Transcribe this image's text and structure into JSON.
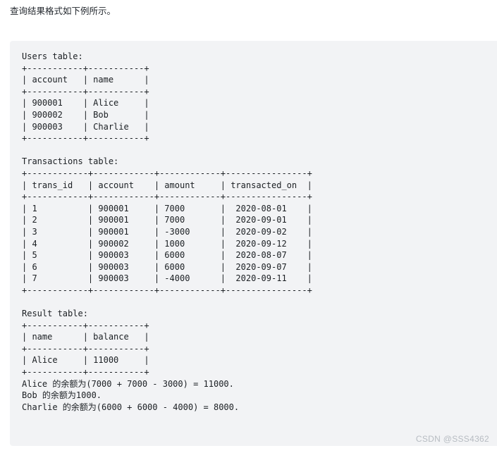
{
  "intro": {
    "text": "查询结果格式如下例所示。"
  },
  "code_block": {
    "background": "#f2f3f5",
    "text_color": "#1b1f23",
    "lines": [
      "Users table:",
      "+-----------+-----------+",
      "| account   | name      |",
      "+-----------+-----------+",
      "| 900001    | Alice     |",
      "| 900002    | Bob       |",
      "| 900003    | Charlie   |",
      "+-----------+-----------+",
      "",
      "Transactions table:",
      "+------------+------------+------------+----------------+",
      "| trans_id   | account    | amount     | transacted_on  |",
      "+------------+------------+------------+----------------+",
      "| 1          | 900001     | 7000       |  2020-08-01    |",
      "| 2          | 900001     | 7000       |  2020-09-01    |",
      "| 3          | 900001     | -3000      |  2020-09-02    |",
      "| 4          | 900002     | 1000       |  2020-09-12    |",
      "| 5          | 900003     | 6000       |  2020-08-07    |",
      "| 6          | 900003     | 6000       |  2020-09-07    |",
      "| 7          | 900003     | -4000      |  2020-09-11    |",
      "+------------+------------+------------+----------------+",
      "",
      "Result table:",
      "+-----------+-----------+",
      "| name      | balance   |",
      "+-----------+-----------+",
      "| Alice     | 11000     |",
      "+-----------+-----------+",
      "Alice 的余额为(7000 + 7000 - 3000) = 11000.",
      "Bob 的余额为1000.",
      "Charlie 的余额为(6000 + 6000 - 4000) = 8000."
    ]
  },
  "watermark": {
    "text": "CSDN @SSS4362"
  },
  "tables": {
    "users": {
      "title": "Users table:",
      "columns": [
        "account",
        "name"
      ],
      "rows": [
        [
          "900001",
          "Alice"
        ],
        [
          "900002",
          "Bob"
        ],
        [
          "900003",
          "Charlie"
        ]
      ]
    },
    "transactions": {
      "title": "Transactions table:",
      "columns": [
        "trans_id",
        "account",
        "amount",
        "transacted_on"
      ],
      "rows": [
        [
          "1",
          "900001",
          "7000",
          "2020-08-01"
        ],
        [
          "2",
          "900001",
          "7000",
          "2020-09-01"
        ],
        [
          "3",
          "900001",
          "-3000",
          "2020-09-02"
        ],
        [
          "4",
          "900002",
          "1000",
          "2020-09-12"
        ],
        [
          "5",
          "900003",
          "6000",
          "2020-08-07"
        ],
        [
          "6",
          "900003",
          "6000",
          "2020-09-07"
        ],
        [
          "7",
          "900003",
          "-4000",
          "2020-09-11"
        ]
      ]
    },
    "result": {
      "title": "Result table:",
      "columns": [
        "name",
        "balance"
      ],
      "rows": [
        [
          "Alice",
          "11000"
        ]
      ]
    }
  },
  "explanations": [
    "Alice 的余额为(7000 + 7000 - 3000) = 11000.",
    "Bob 的余额为1000.",
    "Charlie 的余额为(6000 + 6000 - 4000) = 8000."
  ]
}
